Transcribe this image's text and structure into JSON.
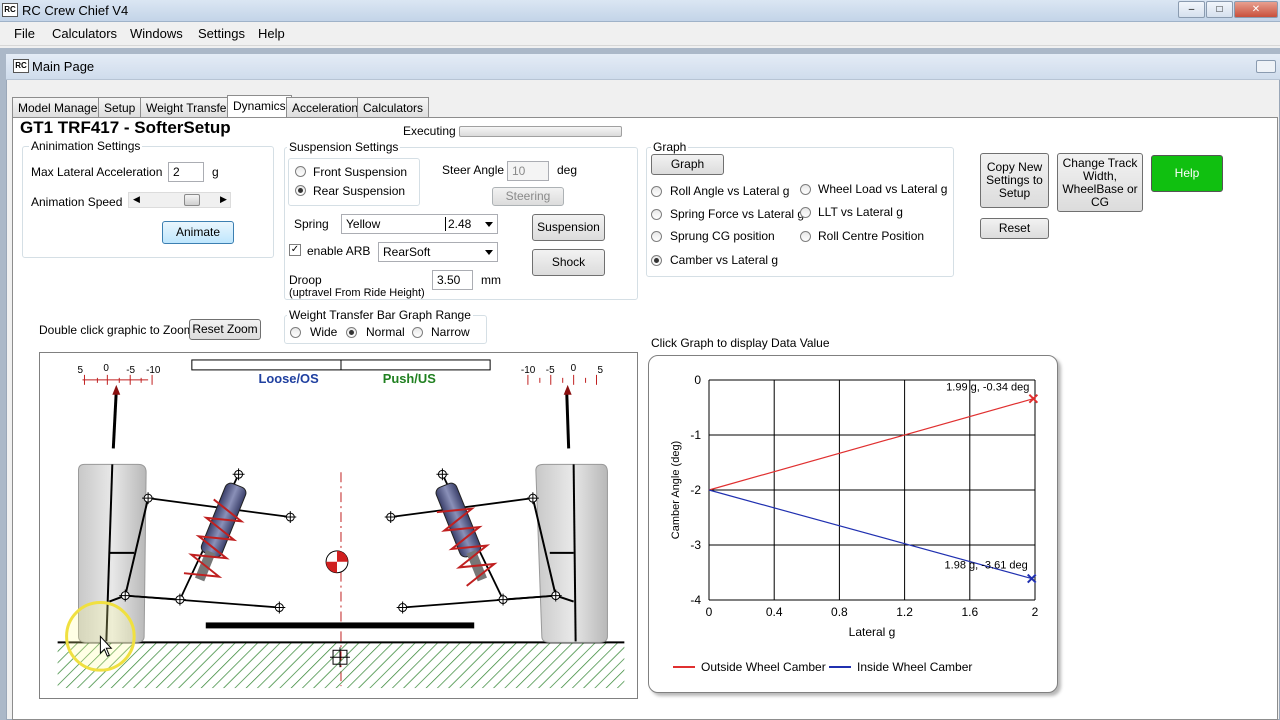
{
  "app": {
    "title": "RC Crew Chief V4",
    "icon_text": "RC"
  },
  "menu": [
    "File",
    "Calculators",
    "Windows",
    "Settings",
    "Help"
  ],
  "child": {
    "title": "Main Page"
  },
  "tabs": [
    {
      "label": "Model Manager",
      "active": false
    },
    {
      "label": "Setup",
      "active": false
    },
    {
      "label": "Weight Transfer",
      "active": false
    },
    {
      "label": "Dynamics",
      "active": true
    },
    {
      "label": "Acceleration",
      "active": false
    },
    {
      "label": "Calculators",
      "active": false
    }
  ],
  "model_title": "GT1 TRF417  - SofterSetup",
  "executing": {
    "label": "Executing"
  },
  "animation": {
    "group_label": "Aninimation Settings",
    "max_lat_label": "Max Lateral Acceleration",
    "max_lat_value": "2",
    "max_lat_unit": "g",
    "speed_label": "Animation Speed",
    "speed_level": 0.7,
    "animate_label": "Animate"
  },
  "suspension": {
    "group_label": "Suspension Settings",
    "front_label": "Front Suspension",
    "rear_label": "Rear Suspension",
    "selected": "rear",
    "steer_label": "Steer Angle",
    "steer_value": "10",
    "steer_unit": "deg",
    "steering_label": "Steering",
    "spring_label": "Spring",
    "spring_value": "Yellow",
    "spring_rate": "2.48",
    "arb_label": "enable ARB",
    "arb_checked": true,
    "arb_value": "RearSoft",
    "droop_label": "Droop",
    "droop_sub": "(uptravel From Ride Height)",
    "droop_value": "3.50",
    "droop_unit": "mm",
    "suspension_btn": "Suspension",
    "shock_btn": "Shock"
  },
  "graph_group": {
    "group_label": "Graph",
    "graph_btn": "Graph",
    "options": [
      {
        "label": "Roll Angle vs Lateral g",
        "selected": false
      },
      {
        "label": "Wheel Load vs Lateral g",
        "selected": false
      },
      {
        "label": "Spring Force vs Lateral g",
        "selected": false
      },
      {
        "label": "LLT vs Lateral g",
        "selected": false
      },
      {
        "label": "Sprung CG  position",
        "selected": false
      },
      {
        "label": "Roll Centre Position",
        "selected": false
      },
      {
        "label": "Camber vs Lateral g",
        "selected": true
      }
    ]
  },
  "actions": {
    "copy_btn": "Copy New Settings to Setup",
    "change_btn": "Change Track Width, WheelBase or CG",
    "help_btn": "Help",
    "reset_btn": "Reset"
  },
  "zoom": {
    "hint": "Double click graphic to Zoom",
    "reset_btn": "Reset Zoom"
  },
  "wt_range": {
    "group_label": "Weight Transfer Bar Graph Range",
    "options": [
      "Wide",
      "Normal",
      "Narrow"
    ],
    "selected": "Normal"
  },
  "graphic": {
    "loose_label": "Loose/OS",
    "push_label": "Push/US",
    "left_scale": [
      "5",
      "0",
      "-5",
      "-10"
    ],
    "right_scale": [
      "-10",
      "-5",
      "0",
      "5"
    ]
  },
  "chart_hint": "Click Graph to display Data Value",
  "chart_data": {
    "type": "line",
    "xlabel": "Lateral g",
    "ylabel": "Camber Angle (deg)",
    "xlim": [
      0,
      2
    ],
    "ylim": [
      -4,
      0
    ],
    "xticks": [
      "0",
      "0.4",
      "0.8",
      "1.2",
      "1.6",
      "2"
    ],
    "yticks": [
      "0",
      "-1",
      "-2",
      "-3",
      "-4"
    ],
    "grid": true,
    "legend_position": "bottom",
    "series": [
      {
        "name": "Outside Wheel Camber",
        "color": "#e03030",
        "x": [
          0,
          1.99
        ],
        "y": [
          -2.0,
          -0.34
        ]
      },
      {
        "name": "Inside Wheel Camber",
        "color": "#2030b0",
        "x": [
          0,
          1.98
        ],
        "y": [
          -2.0,
          -3.61
        ]
      }
    ],
    "annotations": [
      "1.99 g, -0.34 deg",
      "1.98 g, -3.61 deg"
    ]
  },
  "colors": {
    "help_green": "#10c010",
    "spring_red": "#c02020"
  }
}
